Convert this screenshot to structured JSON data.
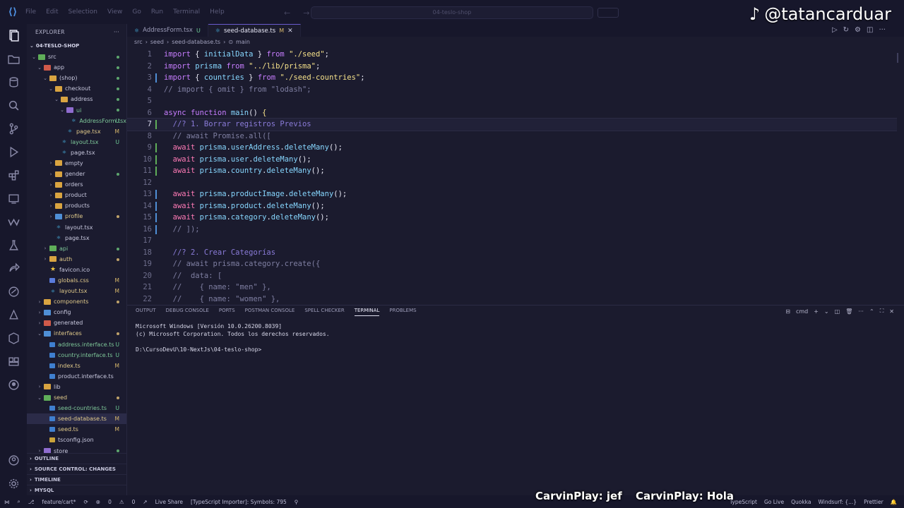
{
  "titlebar": {
    "menu": [
      "File",
      "Edit",
      "Selection",
      "View",
      "Go",
      "Run",
      "Terminal",
      "Help"
    ],
    "command_center": "04-teslo-shop",
    "watermark": "@tatancarduar"
  },
  "explorer": {
    "header": "EXPLORER",
    "root": "04-TESLO-SHOP",
    "items": [
      {
        "label": "src",
        "indent": 0,
        "type": "folder-green",
        "open": true,
        "badge": "dot"
      },
      {
        "label": "app",
        "indent": 1,
        "type": "folder-red",
        "open": true,
        "badge": "dot"
      },
      {
        "label": "(shop)",
        "indent": 2,
        "type": "folder",
        "open": true,
        "badge": "dot"
      },
      {
        "label": "checkout",
        "indent": 3,
        "type": "folder",
        "open": true,
        "badge": "dot"
      },
      {
        "label": "address",
        "indent": 4,
        "type": "folder",
        "open": true,
        "badge": "dot"
      },
      {
        "label": "ui",
        "indent": 5,
        "type": "folder-purple",
        "open": true,
        "badge": "dot",
        "cls": "untr"
      },
      {
        "label": "AddressForm.tsx",
        "indent": 6,
        "type": "tsx",
        "badge": "U",
        "cls": "untr"
      },
      {
        "label": "page.tsx",
        "indent": 5,
        "type": "tsx",
        "badge": "M",
        "cls": "mod"
      },
      {
        "label": "layout.tsx",
        "indent": 4,
        "type": "tsx",
        "badge": "U",
        "cls": "untr"
      },
      {
        "label": "page.tsx",
        "indent": 4,
        "type": "tsx",
        "badge": ""
      },
      {
        "label": "empty",
        "indent": 3,
        "type": "folder",
        "open": false,
        "badge": ""
      },
      {
        "label": "gender",
        "indent": 3,
        "type": "folder",
        "open": false,
        "badge": "dot"
      },
      {
        "label": "orders",
        "indent": 3,
        "type": "folder",
        "open": false,
        "badge": ""
      },
      {
        "label": "product",
        "indent": 3,
        "type": "folder",
        "open": false,
        "badge": ""
      },
      {
        "label": "products",
        "indent": 3,
        "type": "folder",
        "open": false,
        "badge": ""
      },
      {
        "label": "profile",
        "indent": 3,
        "type": "folder-blue",
        "open": false,
        "badge": "dot",
        "cls": "mod"
      },
      {
        "label": "layout.tsx",
        "indent": 3,
        "type": "tsx",
        "badge": ""
      },
      {
        "label": "page.tsx",
        "indent": 3,
        "type": "tsx",
        "badge": ""
      },
      {
        "label": "api",
        "indent": 2,
        "type": "folder-green",
        "open": false,
        "badge": "dot",
        "cls": "untr"
      },
      {
        "label": "auth",
        "indent": 2,
        "type": "folder",
        "open": false,
        "badge": "dot",
        "cls": "mod"
      },
      {
        "label": "favicon.ico",
        "indent": 2,
        "type": "star",
        "badge": ""
      },
      {
        "label": "globals.css",
        "indent": 2,
        "type": "css",
        "badge": "M",
        "cls": "mod"
      },
      {
        "label": "layout.tsx",
        "indent": 2,
        "type": "tsx",
        "badge": "M",
        "cls": "mod"
      },
      {
        "label": "components",
        "indent": 1,
        "type": "folder",
        "open": false,
        "badge": "dot",
        "cls": "mod"
      },
      {
        "label": "config",
        "indent": 1,
        "type": "folder-blue",
        "open": false,
        "badge": ""
      },
      {
        "label": "generated",
        "indent": 1,
        "type": "folder-red",
        "open": false,
        "badge": ""
      },
      {
        "label": "interfaces",
        "indent": 1,
        "type": "folder-blue",
        "open": true,
        "badge": "dot",
        "cls": "mod"
      },
      {
        "label": "address.interface.ts",
        "indent": 2,
        "type": "ts",
        "badge": "U",
        "cls": "untr"
      },
      {
        "label": "country.interface.ts",
        "indent": 2,
        "type": "ts",
        "badge": "U",
        "cls": "untr"
      },
      {
        "label": "index.ts",
        "indent": 2,
        "type": "ts",
        "badge": "M",
        "cls": "mod"
      },
      {
        "label": "product.interface.ts",
        "indent": 2,
        "type": "ts",
        "badge": ""
      },
      {
        "label": "lib",
        "indent": 1,
        "type": "folder",
        "open": false,
        "badge": ""
      },
      {
        "label": "seed",
        "indent": 1,
        "type": "folder-green",
        "open": true,
        "badge": "dot",
        "cls": "mod"
      },
      {
        "label": "seed-countries.ts",
        "indent": 2,
        "type": "ts",
        "badge": "U",
        "cls": "untr"
      },
      {
        "label": "seed-database.ts",
        "indent": 2,
        "type": "ts",
        "badge": "M",
        "cls": "mod",
        "selected": true
      },
      {
        "label": "seed.ts",
        "indent": 2,
        "type": "ts",
        "badge": "M",
        "cls": "mod"
      },
      {
        "label": "tsconfig.json",
        "indent": 2,
        "type": "json",
        "badge": ""
      },
      {
        "label": "store",
        "indent": 1,
        "type": "folder-purple",
        "open": false,
        "badge": "dot"
      }
    ],
    "sections": [
      "OUTLINE",
      "SOURCE CONTROL: CHANGES",
      "TIMELINE",
      "MYSQL"
    ]
  },
  "tabs": [
    {
      "label": "AddressForm.tsx",
      "mark": "U",
      "active": false
    },
    {
      "label": "seed-database.ts",
      "mark": "M",
      "active": true
    }
  ],
  "breadcrumb": [
    "src",
    "seed",
    "seed-database.ts",
    "main"
  ],
  "code_lines": [
    {
      "n": "1",
      "html": "<span class='kw'>import</span> <span class='pu'>{</span> <span class='fn'>initialData</span> <span class='pu'>}</span> <span class='kw'>from</span> <span class='str'>\"./seed\"</span>;"
    },
    {
      "n": "2",
      "html": "<span class='kw'>import</span> <span class='fn'>prisma</span> <span class='kw'>from</span> <span class='str'>\"../lib/prisma\"</span>;"
    },
    {
      "n": "3",
      "html": "<span class='kw'>import</span> <span class='pu'>{</span> <span class='fn'>countries</span> <span class='pu'>}</span> <span class='kw'>from</span> <span class='str'>\"./seed-countries\"</span>;"
    },
    {
      "n": "4",
      "html": "<span class='cm2'>// import { omit } from \"lodash\";</span>"
    },
    {
      "n": "5",
      "html": ""
    },
    {
      "n": "6",
      "html": "<span class='kw'>async</span> <span class='kw'>function</span> <span class='fn'>main</span>() <span class='str'>{</span>"
    },
    {
      "n": "7",
      "html": "  <span class='cm'>//? 1. Borrar registros Previos</span>",
      "cur": true
    },
    {
      "n": "8",
      "html": "  <span class='cm2'>// await Promise.all([</span>"
    },
    {
      "n": "9",
      "html": "  <span class='kw2'>await</span> <span class='fn'>prisma</span>.<span class='fn'>userAddress</span>.<span class='fn'>deleteMany</span>();"
    },
    {
      "n": "10",
      "html": "  <span class='kw2'>await</span> <span class='fn'>prisma</span>.<span class='fn'>user</span>.<span class='fn'>deleteMany</span>();"
    },
    {
      "n": "11",
      "html": "  <span class='kw2'>await</span> <span class='fn'>prisma</span>.<span class='fn'>country</span>.<span class='fn'>deleteMany</span>();"
    },
    {
      "n": "12",
      "html": ""
    },
    {
      "n": "13",
      "html": "  <span class='kw2'>await</span> <span class='fn'>prisma</span>.<span class='fn'>productImage</span>.<span class='fn'>deleteMany</span>();"
    },
    {
      "n": "14",
      "html": "  <span class='kw2'>await</span> <span class='fn'>prisma</span>.<span class='fn'>product</span>.<span class='fn'>deleteMany</span>();"
    },
    {
      "n": "15",
      "html": "  <span class='kw2'>await</span> <span class='fn'>prisma</span>.<span class='fn'>category</span>.<span class='fn'>deleteMany</span>();"
    },
    {
      "n": "16",
      "html": "  <span class='cm2'>// ]);</span>"
    },
    {
      "n": "17",
      "html": ""
    },
    {
      "n": "18",
      "html": "  <span class='cm'>//? 2. Crear Categorías</span>"
    },
    {
      "n": "19",
      "html": "  <span class='cm2'>// await prisma.category.create({</span>"
    },
    {
      "n": "20",
      "html": "  <span class='cm2'>//  data: [</span>"
    },
    {
      "n": "21",
      "html": "  <span class='cm2'>//    { name: \"men\" },</span>"
    },
    {
      "n": "22",
      "html": "  <span class='cm2'>//    { name: \"women\" },</span>"
    }
  ],
  "gutter_marks": {
    "3": "#4f8fd6",
    "7": "#5fae59",
    "9": "#5fae59",
    "10": "#5fae59",
    "11": "#5fae59",
    "13": "#4f8fd6",
    "14": "#4f8fd6",
    "15": "#4f8fd6",
    "16": "#4f8fd6"
  },
  "panel": {
    "tabs": [
      "OUTPUT",
      "DEBUG CONSOLE",
      "PORTS",
      "POSTMAN CONSOLE",
      "SPELL CHECKER",
      "TERMINAL",
      "PROBLEMS"
    ],
    "active_tab": "TERMINAL",
    "shell": "cmd",
    "terminal_lines": [
      "Microsoft Windows [Versión 10.0.26200.8039]",
      "(c) Microsoft Corporation. Todos los derechos reservados.",
      "",
      "D:\\CursoDevU\\10-NextJs\\04-teslo-shop>"
    ]
  },
  "statusbar": {
    "branch": "feature/cart*",
    "errors": "0",
    "warnings": "0",
    "live_share": "Live Share",
    "ts_importer": "[TypeScript Importer]: Symbols: 795",
    "language": "TypeScript",
    "go_live": "Go Live",
    "quokka": "Quokka",
    "windsurf": "Windsurf: {...}",
    "prettier": "Prettier"
  },
  "chat_overlay": [
    "CarvinPlay: jef",
    "CarvinPlay: Hola"
  ],
  "colors": {
    "accent": "#6a5acd",
    "modified": "#d8b86c",
    "untracked": "#6fcf97"
  }
}
